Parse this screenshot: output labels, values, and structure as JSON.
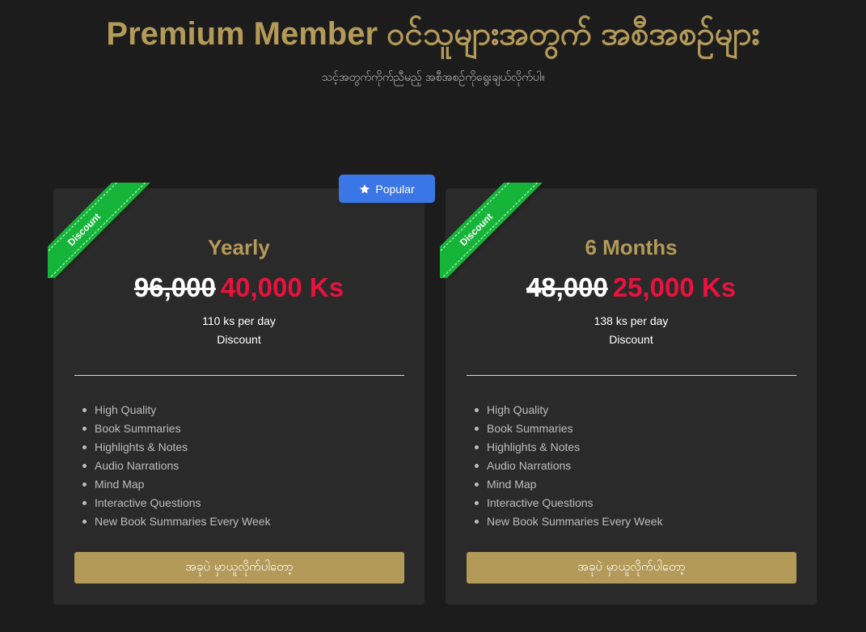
{
  "header": {
    "title": "Premium Member ဝင်သူများအတွက် အစီအစဉ်များ",
    "subtitle": "သင့်အတွက်ကိုက်ညီမည့် အစီအစဉ်ကိုရွေးချယ်လိုက်ပါ။"
  },
  "popular_badge": {
    "icon": "star-icon",
    "label": "Popular"
  },
  "colors": {
    "accent": "#b39a59",
    "sale_price": "#e8123d",
    "ribbon": "#16b53a",
    "badge": "#3b76e6"
  },
  "plans": [
    {
      "ribbon": "Discount",
      "name": "Yearly",
      "old_price": "96,000",
      "new_price": "40,000 Ks",
      "per_day": "110 ks per day",
      "discount_label": "Discount",
      "features": [
        "High Quality",
        "Book Summaries",
        "Highlights & Notes",
        "Audio Narrations",
        "Mind Map",
        "Interactive Questions",
        "New Book Summaries Every Week"
      ],
      "button": "အခုပဲ မှာယူလိုက်ပါတော့"
    },
    {
      "ribbon": "Discount",
      "name": "6 Months",
      "old_price": "48,000",
      "new_price": "25,000 Ks",
      "per_day": "138 ks per day",
      "discount_label": "Discount",
      "features": [
        "High Quality",
        "Book Summaries",
        "Highlights & Notes",
        "Audio Narrations",
        "Mind Map",
        "Interactive Questions",
        "New Book Summaries Every Week"
      ],
      "button": "အခုပဲ မှာယူလိုက်ပါတော့"
    }
  ]
}
